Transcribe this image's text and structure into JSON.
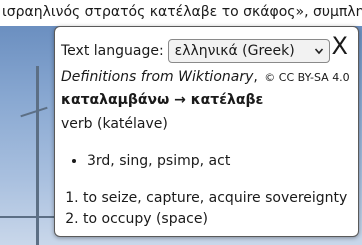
{
  "page": {
    "snippet": "ισραηλινός στρατός κατέλαβε το σκάφος», συμπληρ"
  },
  "popup": {
    "language_label": "Text language:",
    "language_value": "ελληνικά (Greek)",
    "close_glyph": "X",
    "source_title": "Definitions from Wiktionary",
    "source_sep": ",",
    "license": "© CC BY-SA 4.0",
    "headword": "καταλαμβάνω → κατέλαβε",
    "part_of_speech": "verb (katélave)",
    "grammar": [
      "3rd, sing, psimp, act"
    ],
    "senses": [
      "to seize, capture, acquire sovereignty",
      "to occupy (space)"
    ]
  }
}
